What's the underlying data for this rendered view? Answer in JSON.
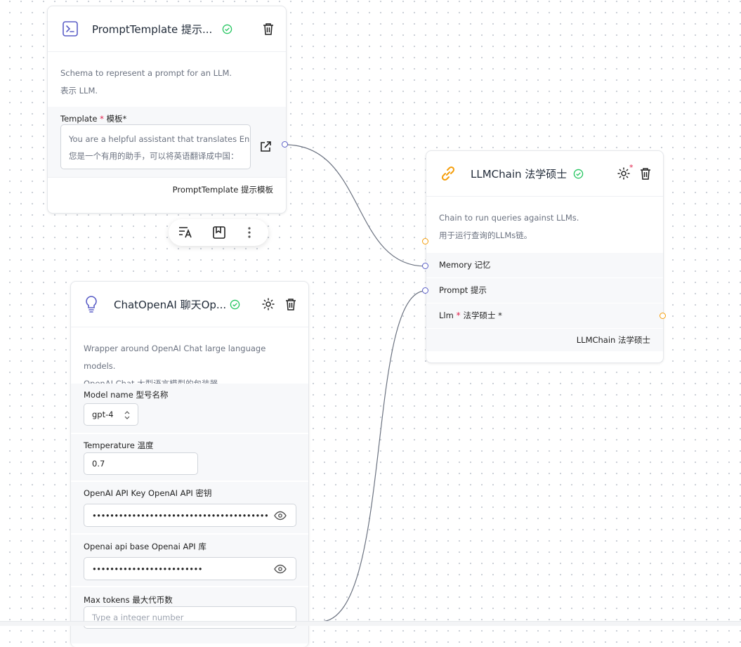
{
  "prompt_node": {
    "title": "PromptTemplate 提示...",
    "desc_en": "Schema to represent a prompt for an LLM.",
    "desc_zh": "表示 LLM.",
    "template_label": "Template",
    "template_req": "*",
    "template_label_zh": "模板*",
    "template_line1": "You are a helpful assistant that translates En...",
    "template_line2": "您是一个有用的助手，可以将英语翻译成中国：",
    "footer": "PromptTemplate 提示模板"
  },
  "llmchain_node": {
    "title": "LLMChain 法学硕士",
    "desc_en": "Chain to run queries against LLMs.",
    "desc_zh": "用于运行查询的LLMs链。",
    "memory_label": "Memory 记忆",
    "prompt_label": "Prompt 提示",
    "llm_label": "Llm",
    "llm_req": "*",
    "llm_label_zh": "法学硕士 *",
    "footer": "LLMChain 法学硕士"
  },
  "chat_node": {
    "title": "ChatOpenAI 聊天Op...",
    "desc_en": "Wrapper around OpenAI Chat large language models.",
    "desc_zh": "OpenAI Chat 大型语言模型的包装器。",
    "model_label": "Model name 型号名称",
    "model_value": "gpt-4",
    "temp_label": "Temperature 温度",
    "temp_value": "0.7",
    "key_label": "OpenAI API Key OpenAI API 密钥",
    "key_value": "•••••••••••••••••••••••••••••••••••••••••••••••",
    "base_label": "Openai api base Openai API 库",
    "base_value": "•••••••••••••••••••••••••",
    "max_label": "Max tokens 最大代币数",
    "max_placeholder": "Type a integer number"
  },
  "colors": {
    "accent": "#5b5fc7",
    "success": "#22c55e",
    "orange": "#f59e0b",
    "required": "#e11d48"
  },
  "icons": [
    "terminal-icon",
    "check-circle-icon",
    "trash-icon",
    "external-link-icon",
    "text-translate-icon",
    "bookmark-icon",
    "more-vertical-icon",
    "link-icon",
    "gear-icon",
    "lightbulb-icon",
    "chevron-updown-icon",
    "eye-icon"
  ]
}
